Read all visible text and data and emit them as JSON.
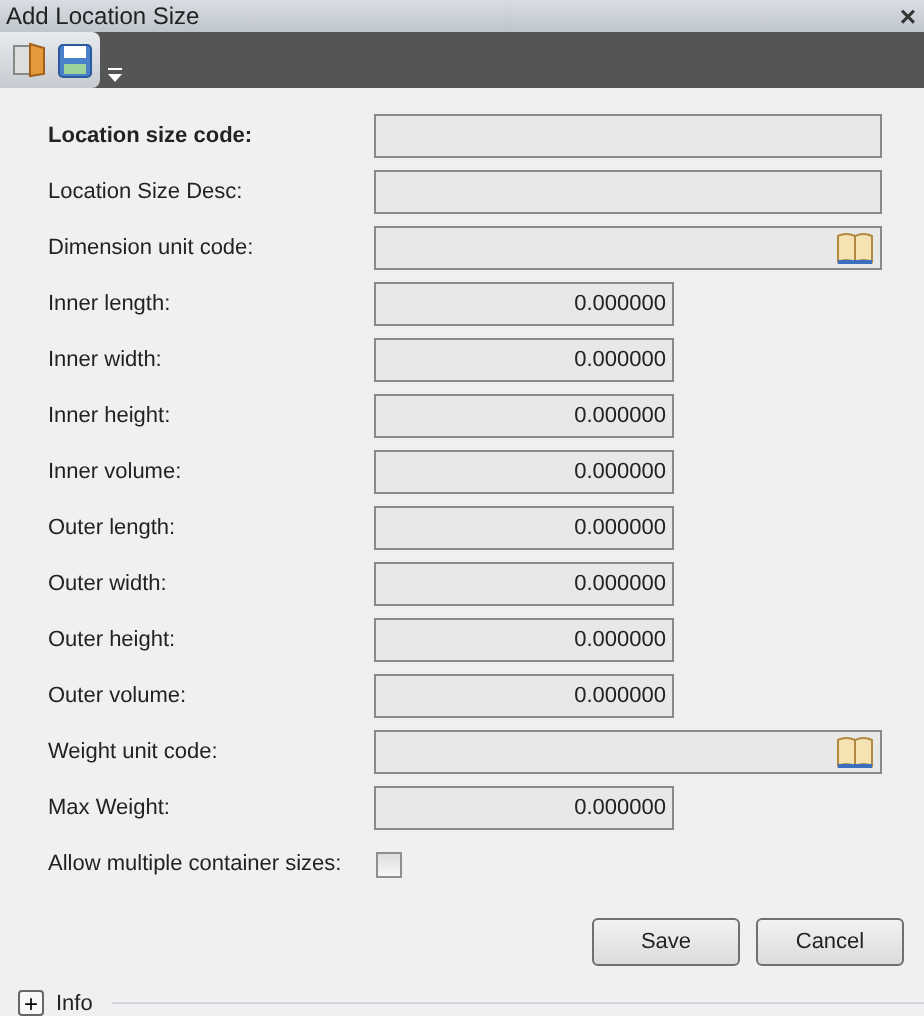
{
  "window": {
    "title": "Add Location Size",
    "close": "×"
  },
  "fields": [
    {
      "kind": "text",
      "label": "Location size code:",
      "required": true
    },
    {
      "kind": "text",
      "label": "Location Size Desc:",
      "required": false
    },
    {
      "kind": "lookup",
      "label": "Dimension unit code:",
      "required": false
    },
    {
      "kind": "number",
      "label": "Inner length:",
      "required": false,
      "value": "0.000000"
    },
    {
      "kind": "number",
      "label": "Inner width:",
      "required": false,
      "value": "0.000000"
    },
    {
      "kind": "number",
      "label": "Inner height:",
      "required": false,
      "value": "0.000000"
    },
    {
      "kind": "number",
      "label": "Inner volume:",
      "required": false,
      "value": "0.000000"
    },
    {
      "kind": "number",
      "label": "Outer length:",
      "required": false,
      "value": "0.000000"
    },
    {
      "kind": "number",
      "label": "Outer width:",
      "required": false,
      "value": "0.000000"
    },
    {
      "kind": "number",
      "label": "Outer height:",
      "required": false,
      "value": "0.000000"
    },
    {
      "kind": "number",
      "label": "Outer volume:",
      "required": false,
      "value": "0.000000"
    },
    {
      "kind": "lookup",
      "label": "Weight unit code:",
      "required": false
    },
    {
      "kind": "number",
      "label": "Max Weight:",
      "required": false,
      "value": "0.000000"
    },
    {
      "kind": "checkbox",
      "label": "Allow multiple container sizes:",
      "required": false,
      "checked": false
    }
  ],
  "buttons": [
    "Save",
    "Cancel"
  ],
  "info": {
    "label": "Info",
    "expander": "+",
    "expanded": false
  }
}
